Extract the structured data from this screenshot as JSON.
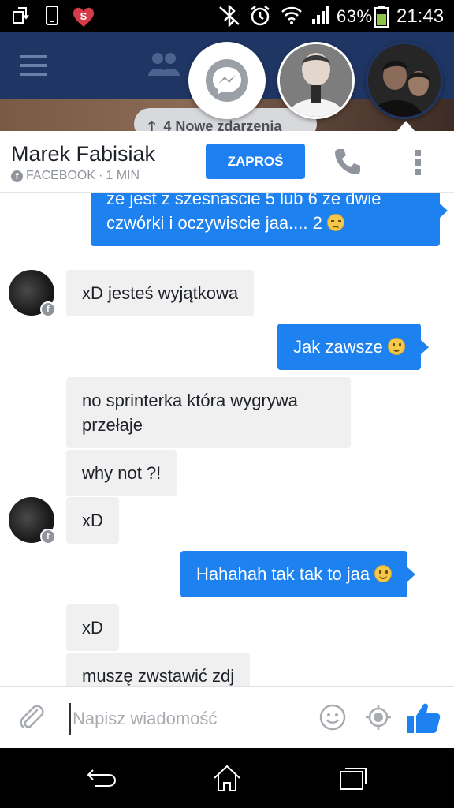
{
  "status_bar": {
    "battery_percent": "63%",
    "time": "21:43"
  },
  "background_app": {
    "new_events_count": "4",
    "new_events_label": "Nowe zdarzenia"
  },
  "chat_header": {
    "contact_name": "Marek Fabisiak",
    "source": "FACEBOOK",
    "separator": "·",
    "last_active": "1 MIN",
    "invite_label": "ZAPROŚ"
  },
  "messages": [
    {
      "direction": "out",
      "text": "ze jest z szesnascie  5 lub 6 ze dwie czwórki i oczywiscie jaa.... 2",
      "emoji": "sad"
    },
    {
      "direction": "in",
      "text": "xD jesteś wyjątkowa",
      "avatar": true
    },
    {
      "direction": "out",
      "text": "Jak zawsze",
      "emoji": "smile"
    },
    {
      "direction": "in",
      "text": "no sprinterka która wygrywa przełaje",
      "avatar": false
    },
    {
      "direction": "in",
      "text": "why not ?!",
      "avatar": false
    },
    {
      "direction": "in",
      "text": "xD",
      "avatar": true
    },
    {
      "direction": "out",
      "text": "Hahahah tak tak to jaa",
      "emoji": "smile"
    },
    {
      "direction": "in",
      "text": "xD",
      "avatar": false
    },
    {
      "direction": "in",
      "text": "muszę zwstawić zdj",
      "avatar": false
    }
  ],
  "composer": {
    "placeholder": "Napisz wiadomość",
    "value": ""
  },
  "colors": {
    "accent_blue": "#1d82f0",
    "facebook_navy": "#1f3563",
    "incoming_bubble": "#f1f0f0"
  },
  "icons": {
    "status_left": [
      "screen-rotate-icon",
      "phone-outline-icon",
      "heart-app-icon"
    ],
    "status_right": [
      "bluetooth-off-icon",
      "alarm-clock-icon",
      "wifi-icon",
      "signal-icon",
      "battery-icon"
    ],
    "header": [
      "phone-call-icon",
      "more-vertical-icon"
    ],
    "composer": [
      "paperclip-icon",
      "emoji-icon",
      "location-icon",
      "thumbs-up-icon"
    ],
    "nav": [
      "back-icon",
      "home-icon",
      "recent-apps-icon"
    ]
  }
}
